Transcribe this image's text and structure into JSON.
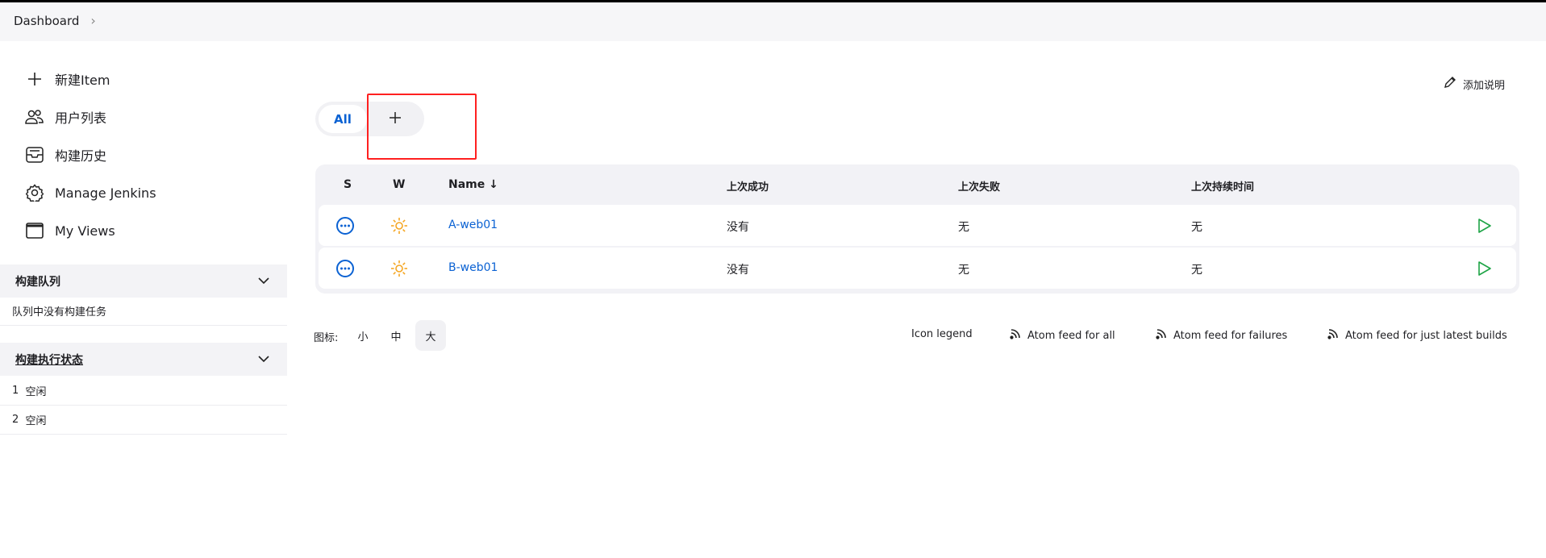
{
  "breadcrumb": {
    "items": [
      "Dashboard"
    ]
  },
  "sidebar": {
    "items": [
      {
        "label": "新建Item",
        "icon": "plus-icon"
      },
      {
        "label": "用户列表",
        "icon": "users-icon"
      },
      {
        "label": "构建历史",
        "icon": "inbox-icon"
      },
      {
        "label": "Manage Jenkins",
        "icon": "gear-icon"
      },
      {
        "label": "My Views",
        "icon": "window-icon"
      }
    ],
    "queue": {
      "title": "构建队列",
      "empty": "队列中没有构建任务"
    },
    "executors": {
      "title": "构建执行状态",
      "rows": [
        {
          "num": "1",
          "status": "空闲"
        },
        {
          "num": "2",
          "status": "空闲"
        }
      ]
    }
  },
  "main": {
    "add_description": "添加说明",
    "tabs": [
      {
        "label": "All",
        "active": true
      },
      {
        "label": "+"
      }
    ],
    "table": {
      "headers": [
        "S",
        "W",
        "Name ↓",
        "上次成功",
        "上次失败",
        "上次持续时间"
      ],
      "rows": [
        {
          "name": "A-web01",
          "last_success": "没有",
          "last_failure": "无",
          "last_duration": "无"
        },
        {
          "name": "B-web01",
          "last_success": "没有",
          "last_failure": "无",
          "last_duration": "无"
        }
      ]
    },
    "icon_size": {
      "label": "图标:",
      "options": [
        "小",
        "中",
        "大"
      ],
      "selected": "大"
    },
    "links": {
      "legend": "Icon legend",
      "feed_all": "Atom feed for all",
      "feed_failures": "Atom feed for failures",
      "feed_latest": "Atom feed for just latest builds"
    }
  },
  "colors": {
    "accent": "#0b62d3",
    "sun": "#f5a623",
    "play": "#1ea446",
    "highlight": "#ff2020"
  }
}
